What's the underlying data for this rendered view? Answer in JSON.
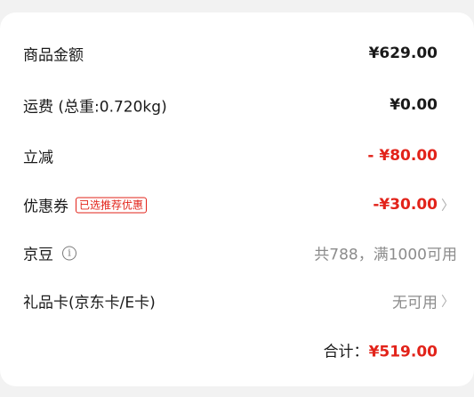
{
  "summary": {
    "items": [
      {
        "label": "商品金额",
        "value": "¥629.00"
      },
      {
        "label": "运费 (总重:0.720kg)",
        "value": "¥0.00"
      },
      {
        "label": "立减",
        "value": "- ¥80.00"
      },
      {
        "label": "优惠券",
        "tag": "已选推荐优惠",
        "value": "-¥30.00"
      },
      {
        "label": "京豆",
        "value": "共788，满1000可用"
      },
      {
        "label": "礼品卡(京东卡/E卡)",
        "value": "无可用"
      }
    ],
    "total_label": "合计：",
    "total_value": "¥519.00",
    "colors": {
      "accent": "#e2231a",
      "muted": "#8c8c8c"
    }
  }
}
